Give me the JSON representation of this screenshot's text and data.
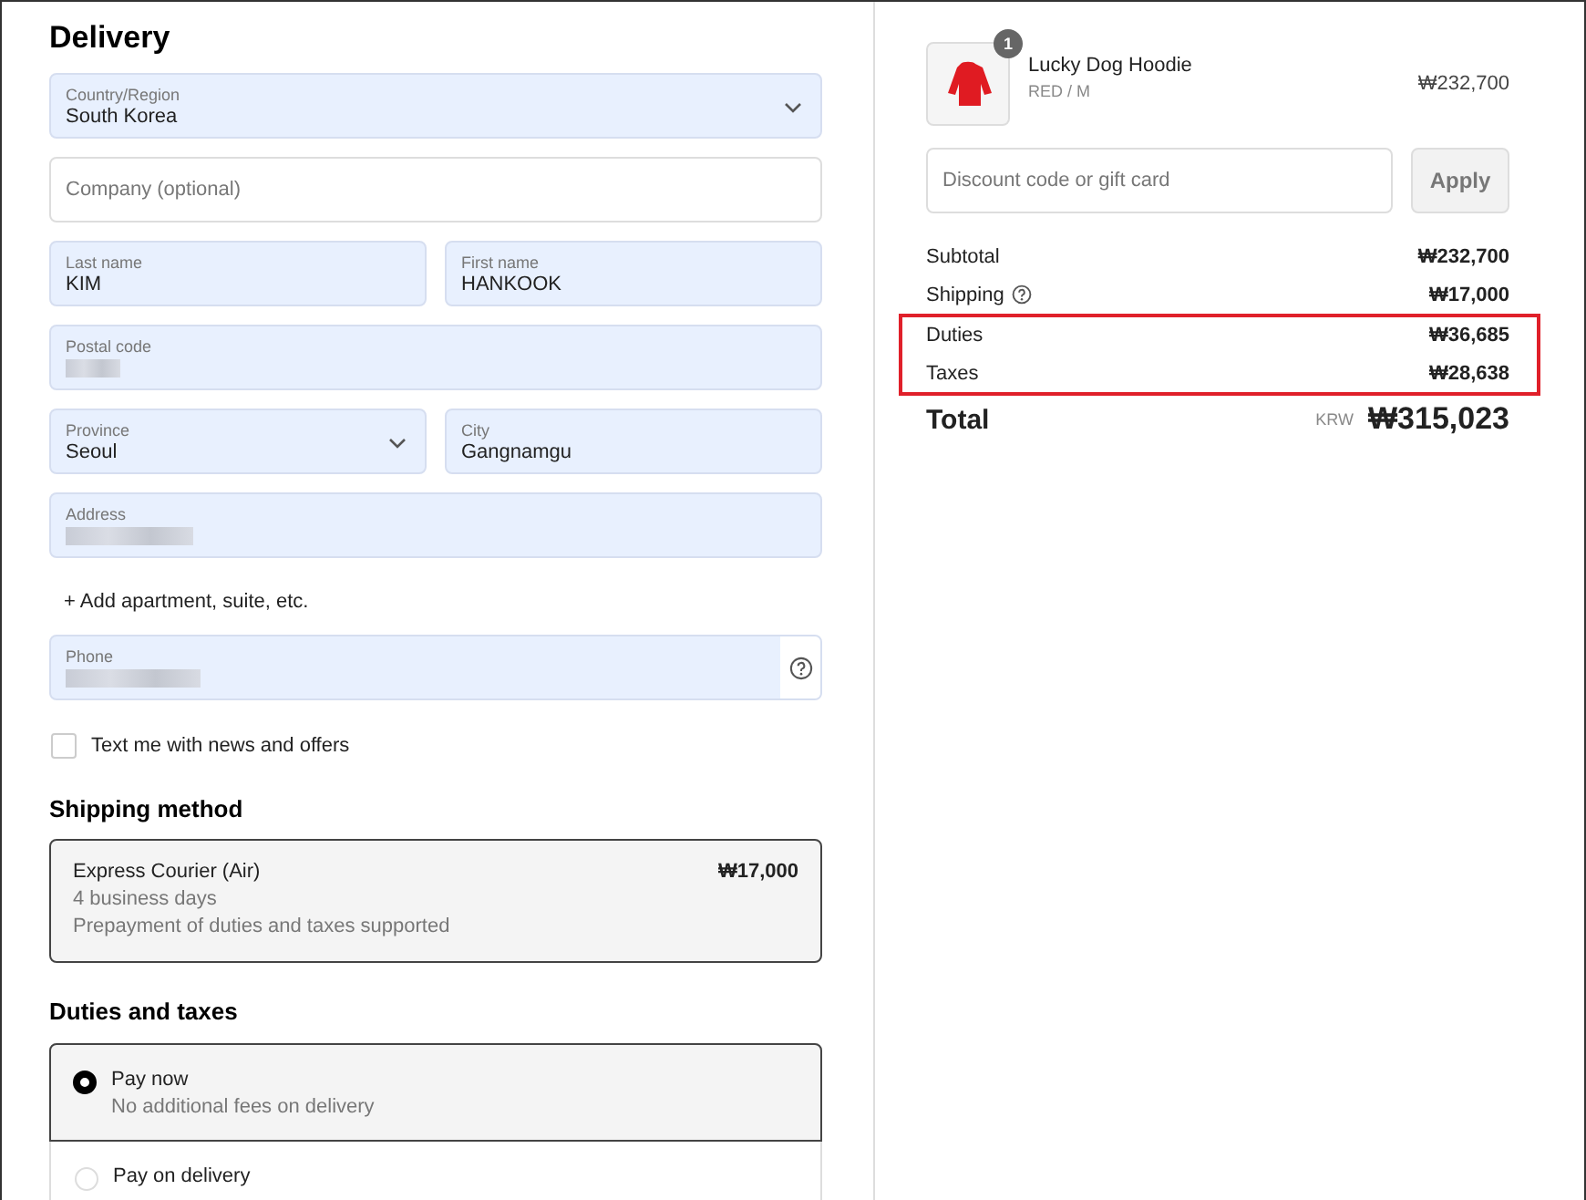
{
  "delivery": {
    "title": "Delivery",
    "rows": [
      [
        {
          "kind": "select",
          "label": "Country/Region",
          "value": "South Korea"
        }
      ],
      [
        {
          "kind": "text",
          "placeholder": "Company (optional)"
        }
      ],
      [
        {
          "kind": "text",
          "label": "Last name",
          "value": "KIM"
        },
        {
          "kind": "text",
          "label": "First name",
          "value": "HANKOOK"
        }
      ],
      [
        {
          "kind": "redacted",
          "label": "Postal code"
        }
      ],
      [
        {
          "kind": "select",
          "label": "Province",
          "value": "Seoul"
        },
        {
          "kind": "text",
          "label": "City",
          "value": "Gangnamgu"
        }
      ],
      [
        {
          "kind": "redacted",
          "label": "Address"
        }
      ]
    ],
    "add_link": "+ Add apartment, suite, etc.",
    "phone": {
      "label": "Phone"
    },
    "sms_opt_in": {
      "label": "Text me with news and offers",
      "checked": false
    }
  },
  "shipping_method": {
    "title": "Shipping method",
    "options": [
      {
        "name": "Express Courier (Air)",
        "details": [
          "4 business days",
          "Prepayment of duties and taxes supported"
        ],
        "price": "₩17,000",
        "selected": true
      }
    ]
  },
  "duties_and_taxes": {
    "title": "Duties and taxes",
    "options": [
      {
        "name": "Pay now",
        "detail": "No additional fees on delivery",
        "selected": true
      },
      {
        "name": "Pay on delivery",
        "selected": false
      }
    ]
  },
  "order": {
    "item": {
      "quantity": "1",
      "name": "Lucky Dog Hoodie",
      "variant": "RED / M",
      "price": "₩232,700"
    },
    "discount": {
      "placeholder": "Discount code or gift card",
      "button": "Apply"
    },
    "lines": [
      {
        "label": "Subtotal",
        "value": "₩232,700",
        "info": false,
        "highlighted": false
      },
      {
        "label": "Shipping",
        "value": "₩17,000",
        "info": true,
        "highlighted": false
      },
      {
        "label": "Duties",
        "value": "₩36,685",
        "info": false,
        "highlighted": true
      },
      {
        "label": "Taxes",
        "value": "₩28,638",
        "info": false,
        "highlighted": true
      }
    ],
    "total": {
      "label": "Total",
      "currency": "KRW",
      "value": "₩315,023"
    }
  }
}
